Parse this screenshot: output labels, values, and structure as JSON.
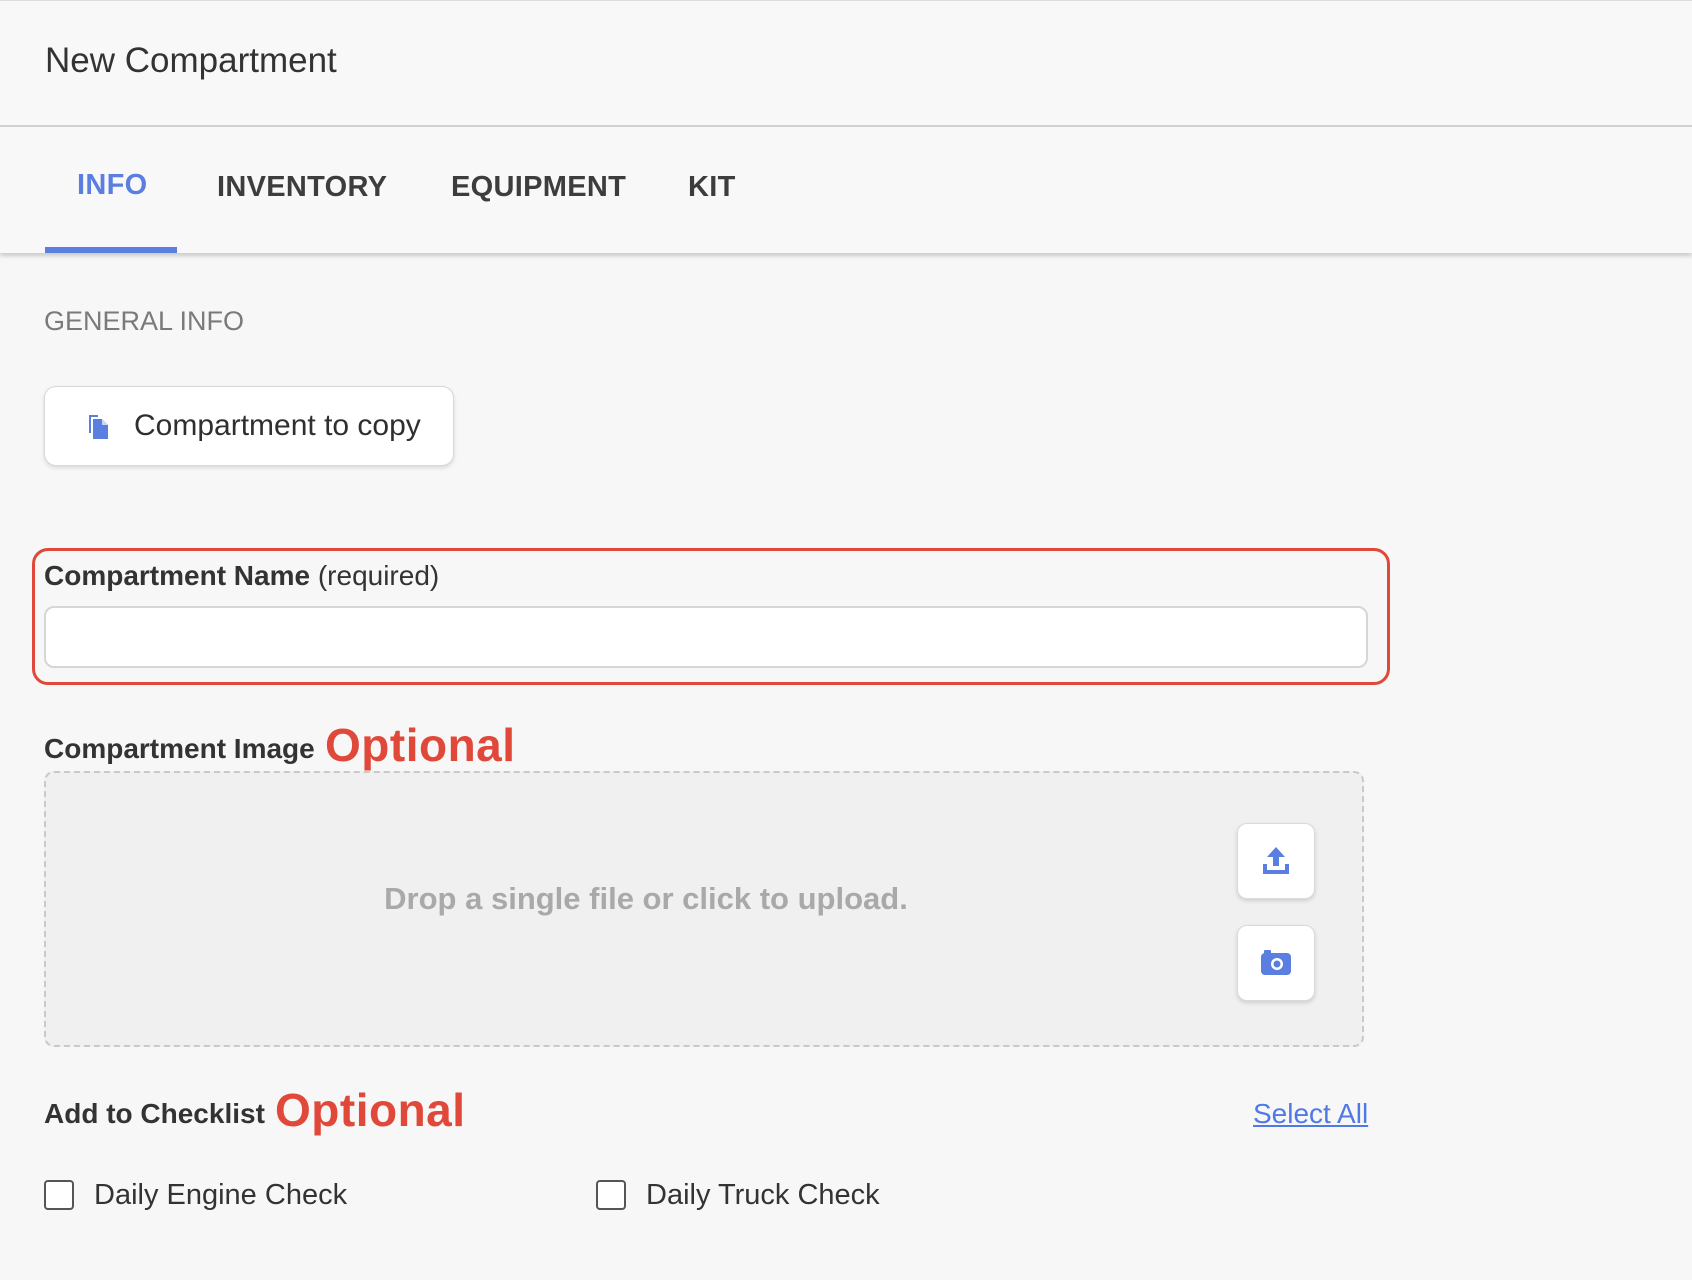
{
  "header": {
    "title": "New Compartment"
  },
  "tabs": [
    {
      "label": "INFO",
      "active": true
    },
    {
      "label": "INVENTORY",
      "active": false
    },
    {
      "label": "EQUIPMENT",
      "active": false
    },
    {
      "label": "KIT",
      "active": false
    }
  ],
  "general": {
    "section_title": "GENERAL INFO",
    "copy_button_label": "Compartment to copy",
    "copy_icon": "copy-document-icon"
  },
  "name_field": {
    "label_bold": "Compartment Name",
    "label_suffix": "(required)",
    "value": "",
    "highlight_color": "#e0483a"
  },
  "image_field": {
    "label": "Compartment Image",
    "annotation": "Optional",
    "drop_text": "Drop a single file or click to upload.",
    "upload_icon": "upload-icon",
    "camera_icon": "camera-icon"
  },
  "checklist": {
    "label": "Add to Checklist",
    "annotation": "Optional",
    "select_all_label": "Select All",
    "items": [
      {
        "label": "Daily Engine Check",
        "checked": false
      },
      {
        "label": "Daily Truck Check",
        "checked": false
      }
    ]
  },
  "colors": {
    "accent": "#5b7fe0",
    "link": "#4f7ae6",
    "annotation": "#e0483a"
  }
}
